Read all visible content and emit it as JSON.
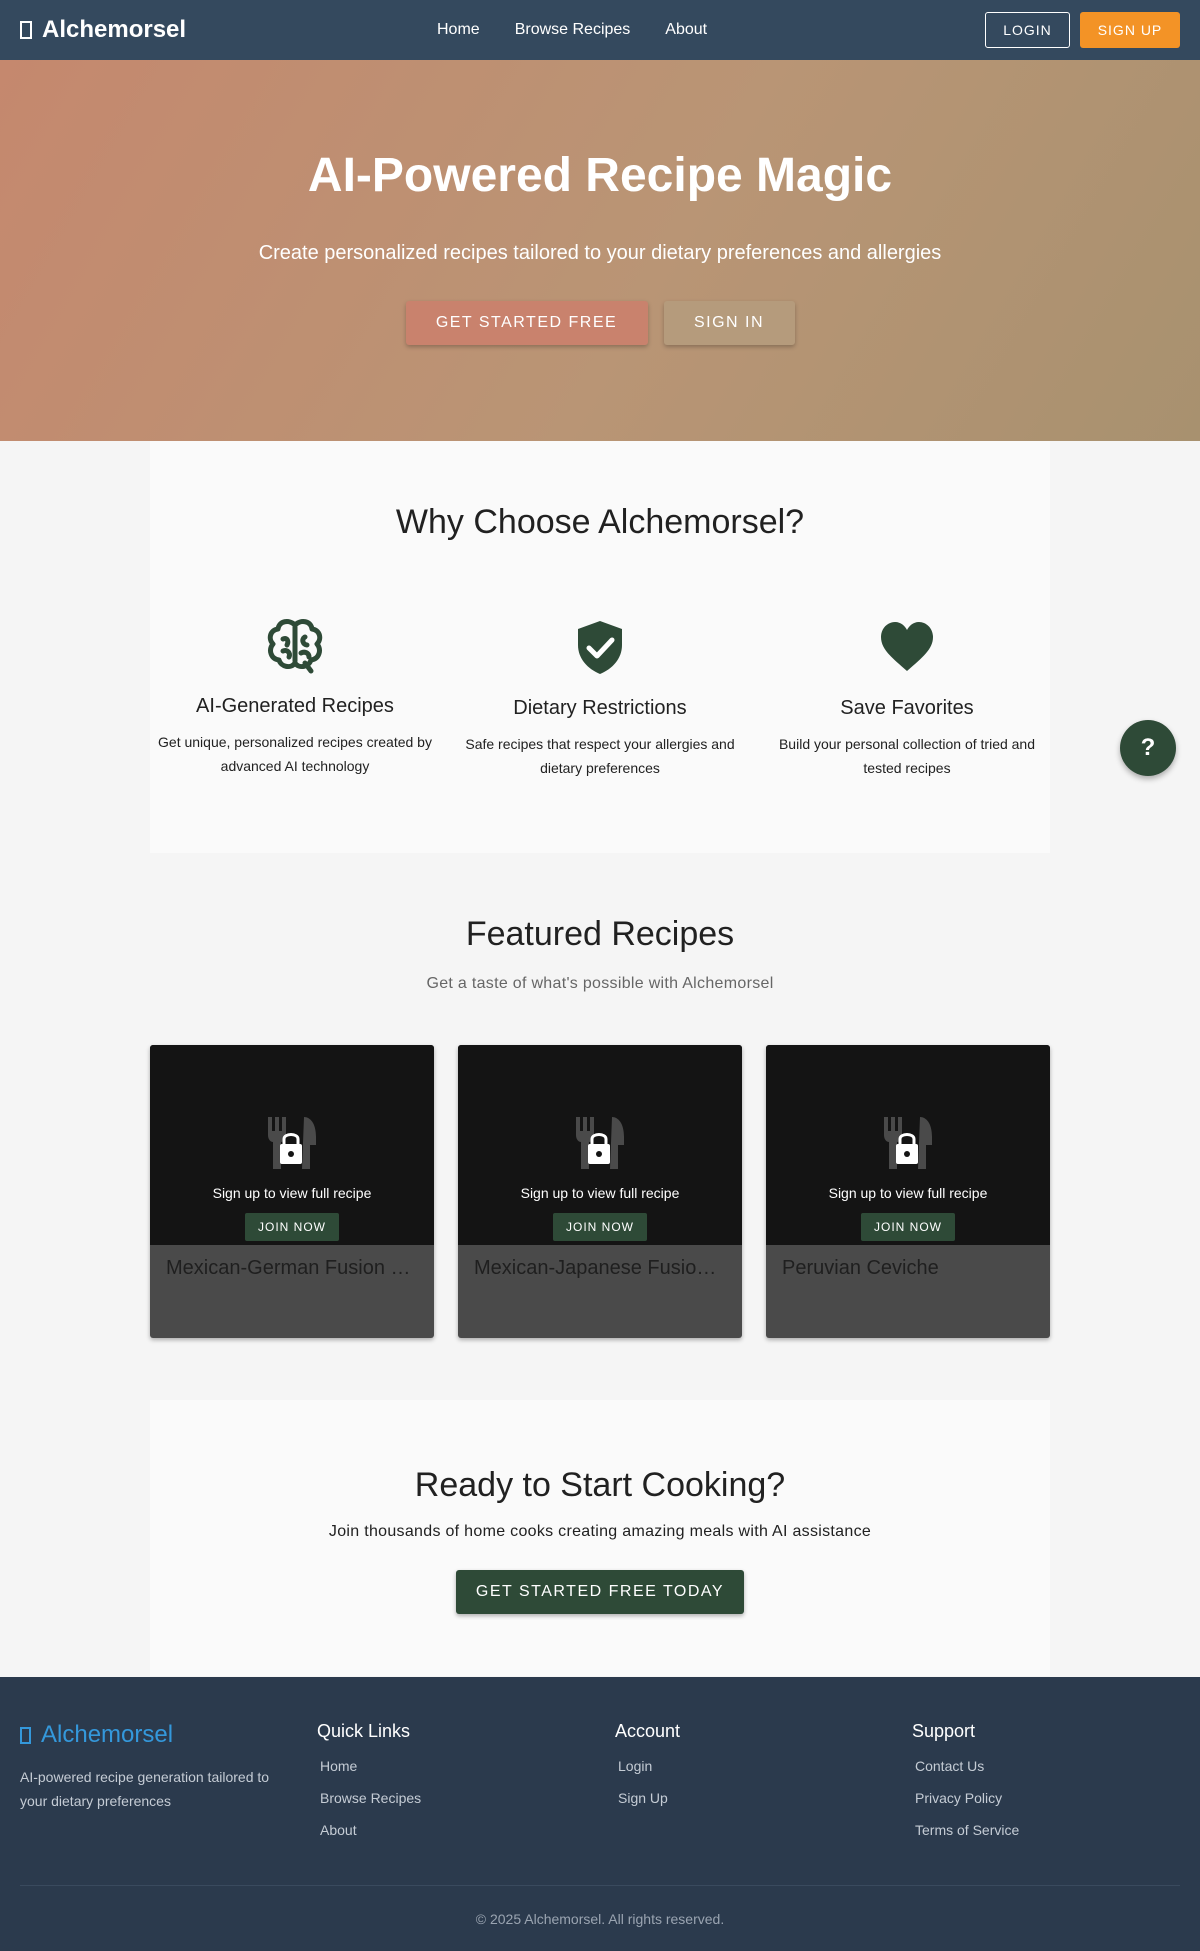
{
  "nav": {
    "brand": "Alchemorsel",
    "links": [
      "Home",
      "Browse Recipes",
      "About"
    ],
    "login": "LOGIN",
    "signup": "SIGN UP"
  },
  "hero": {
    "title": "AI-Powered Recipe Magic",
    "subtitle": "Create personalized recipes tailored to your dietary preferences and allergies",
    "primary_button": "GET STARTED FREE",
    "secondary_button": "SIGN IN"
  },
  "why": {
    "title": "Why Choose Alchemorsel?",
    "features": [
      {
        "icon": "brain-icon",
        "title": "AI-Generated Recipes",
        "desc": "Get unique, personalized recipes created by advanced AI technology"
      },
      {
        "icon": "shield-check-icon",
        "title": "Dietary Restrictions",
        "desc": "Safe recipes that respect your allergies and dietary preferences"
      },
      {
        "icon": "heart-icon",
        "title": "Save Favorites",
        "desc": "Build your personal collection of tried and tested recipes"
      }
    ]
  },
  "help_button": "?",
  "featured": {
    "title": "Featured Recipes",
    "subtitle": "Get a taste of what's possible with Alchemorsel",
    "cards": [
      {
        "title": "Mexican-German Fusion …",
        "overlay_text": "Sign up to view full recipe",
        "join": "JOIN NOW"
      },
      {
        "title": "Mexican-Japanese Fusio…",
        "overlay_text": "Sign up to view full recipe",
        "join": "JOIN NOW"
      },
      {
        "title": "Peruvian Ceviche",
        "overlay_text": "Sign up to view full recipe",
        "join": "JOIN NOW"
      }
    ]
  },
  "cta": {
    "title": "Ready to Start Cooking?",
    "subtitle": "Join thousands of home cooks creating amazing meals with AI assistance",
    "button": "GET STARTED FREE TODAY"
  },
  "footer": {
    "brand": "Alchemorsel",
    "tagline": "AI-powered recipe generation tailored to your dietary preferences",
    "columns": [
      {
        "heading": "Quick Links",
        "links": [
          "Home",
          "Browse Recipes",
          "About"
        ]
      },
      {
        "heading": "Account",
        "links": [
          "Login",
          "Sign Up"
        ]
      },
      {
        "heading": "Support",
        "links": [
          "Contact Us",
          "Privacy Policy",
          "Terms of Service"
        ]
      }
    ],
    "copyright": "© 2025 Alchemorsel. All rights reserved."
  },
  "colors": {
    "navbar": "#34495e",
    "accent_orange": "#f39326",
    "primary_green": "#2e4a37",
    "footer": "#2b3a4d",
    "footer_brand": "#3498db"
  }
}
